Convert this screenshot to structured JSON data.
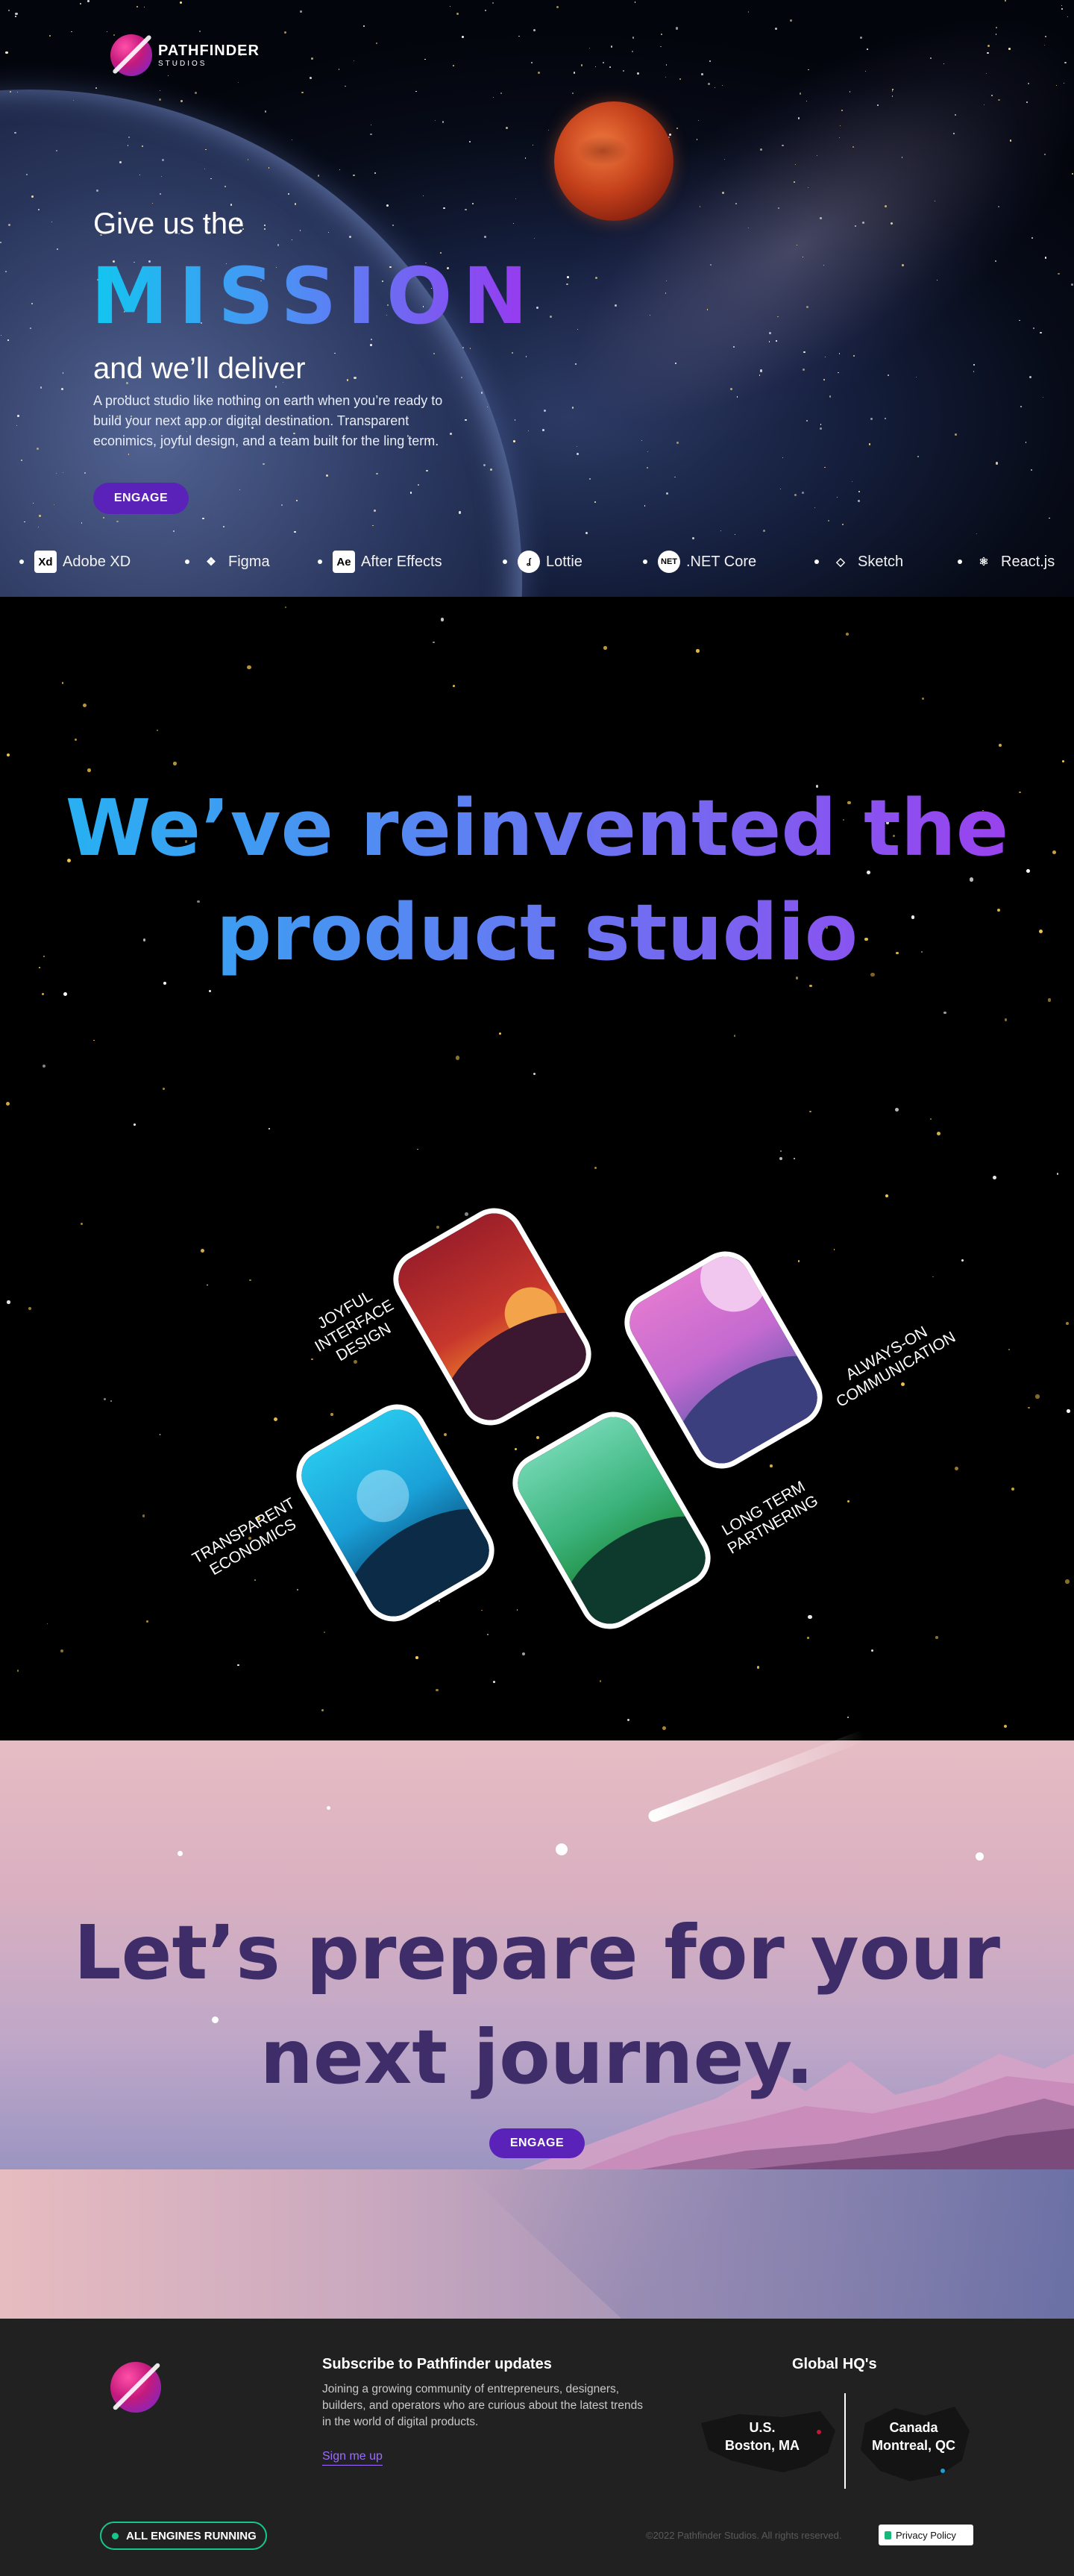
{
  "brand": {
    "name": "PATHFINDER",
    "sub": "STUDIOS"
  },
  "hero": {
    "line1": "Give us the",
    "headline": "MISSION",
    "line3": "and we’ll deliver",
    "body": "A product studio like nothing on earth when you’re ready to build your next app or digital destination. Transparent econimics, joyful design, and a team built for the ling term.",
    "cta": "ENGAGE"
  },
  "tools": [
    {
      "label": "Adobe XD",
      "icon": "adobe-xd-icon",
      "glyph": "Xd"
    },
    {
      "label": "Figma",
      "icon": "figma-icon",
      "glyph": "❖"
    },
    {
      "label": "After Effects",
      "icon": "after-effects-icon",
      "glyph": "Ae"
    },
    {
      "label": "Lottie",
      "icon": "lottie-icon",
      "glyph": "ʆ"
    },
    {
      "label": ".NET Core",
      "icon": "dotnet-icon",
      "glyph": "NET"
    },
    {
      "label": "Sketch",
      "icon": "sketch-icon",
      "glyph": "◇"
    },
    {
      "label": "React.js",
      "icon": "react-icon",
      "glyph": "⚛"
    }
  ],
  "reinvent": {
    "line1": "We’ve reinvented the",
    "line2": "product studio"
  },
  "pillars": [
    {
      "label": "JOYFUL INTERFACE DESIGN"
    },
    {
      "label": "ALWAYS-ON COMMUNICATION"
    },
    {
      "label": "TRANSPARENT ECONOMICS"
    },
    {
      "label": "LONG TERM PARTNERING"
    }
  ],
  "journey": {
    "line1": "Let’s prepare for your",
    "line2": "next journey.",
    "cta": "ENGAGE"
  },
  "footer": {
    "subscribe_title": "Subscribe to Pathfinder updates",
    "subscribe_body": "Joining a growing community of entrepreneurs, designers, builders, and operators who are curious about the latest trends in the world of digital products.",
    "signup": "Sign me up",
    "hq_title": "Global HQ's",
    "hq_us_country": "U.S.",
    "hq_us_city": "Boston, MA",
    "hq_ca_country": "Canada",
    "hq_ca_city": "Montreal, QC",
    "status": "ALL ENGINES RUNNING",
    "copyright": "©2022 Pathfinder Studios. All rights reserved.",
    "privacy": "Privacy Policy"
  },
  "colors": {
    "accent": "#5a22b8",
    "gradient_start": "#12c6f0",
    "gradient_end": "#9b36f0",
    "journey_text": "#3f2d6a",
    "status_green": "#15c78a"
  }
}
